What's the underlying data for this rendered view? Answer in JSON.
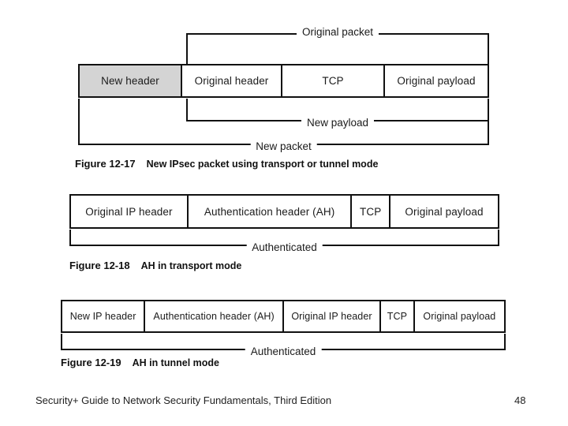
{
  "figures": [
    {
      "id": "figure-12-17",
      "caption_number": "Figure 12-17",
      "caption_text": "New IPsec packet using transport or tunnel mode",
      "cells": [
        {
          "label": "New header",
          "shaded": true
        },
        {
          "label": "Original header",
          "shaded": false
        },
        {
          "label": "TCP",
          "shaded": false
        },
        {
          "label": "Original payload",
          "shaded": false
        }
      ],
      "brackets": [
        {
          "label": "Original packet",
          "direction": "down"
        },
        {
          "label": "New payload",
          "direction": "up"
        },
        {
          "label": "New packet",
          "direction": "up"
        }
      ]
    },
    {
      "id": "figure-12-18",
      "caption_number": "Figure 12-18",
      "caption_text": "AH in transport mode",
      "cells": [
        {
          "label": "Original IP header",
          "shaded": false
        },
        {
          "label": "Authentication header (AH)",
          "shaded": false
        },
        {
          "label": "TCP",
          "shaded": false
        },
        {
          "label": "Original payload",
          "shaded": false
        }
      ],
      "brackets": [
        {
          "label": "Authenticated",
          "direction": "up"
        }
      ]
    },
    {
      "id": "figure-12-19",
      "caption_number": "Figure 12-19",
      "caption_text": "AH in tunnel mode",
      "cells": [
        {
          "label": "New IP header",
          "shaded": false
        },
        {
          "label": "Authentication header (AH)",
          "shaded": false
        },
        {
          "label": "Original IP header",
          "shaded": false
        },
        {
          "label": "TCP",
          "shaded": false
        },
        {
          "label": "Original payload",
          "shaded": false
        }
      ],
      "brackets": [
        {
          "label": "Authenticated",
          "direction": "up"
        }
      ]
    }
  ],
  "footer": {
    "book_title": "Security+ Guide to Network Security Fundamentals, Third Edition",
    "page_number": "48"
  },
  "colors": {
    "line": "#111111",
    "shaded_cell": "#d4d4d4",
    "background": "#ffffff",
    "text": "#1b1b1b"
  }
}
